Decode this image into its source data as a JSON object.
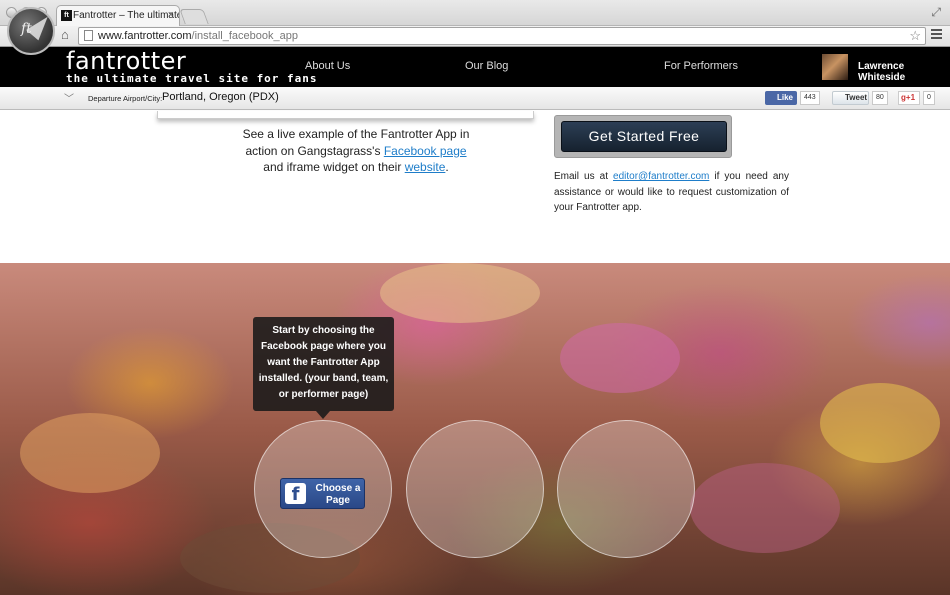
{
  "browser": {
    "tab_title": "Fantrotter – The ultimate t",
    "tab_favicon": "ft",
    "url_domain": "www.fantrotter.com",
    "url_path": "/install_facebook_app"
  },
  "header": {
    "brand_name": "fantrotter",
    "brand_tagline": "the ultimate travel site for fans",
    "logo_text": "ft",
    "nav": [
      "About Us",
      "Our Blog",
      "For Performers"
    ],
    "user_name": "Lawrence Whiteside"
  },
  "departure": {
    "label": "Departure Airport/City:",
    "value": "Portland, Oregon (PDX)"
  },
  "social": {
    "like_label": "Like",
    "like_count": "443",
    "tweet_label": "Tweet",
    "tweet_count": "80",
    "gplus_label": "+1",
    "gplus_count": "0"
  },
  "content": {
    "live_text_1": "See a live example of the Fantrotter App in action on Gangstagrass's ",
    "facebook_link": "Facebook page",
    "live_text_2": " and iframe widget on their ",
    "website_link": "website",
    "live_text_3": ".",
    "cta_label": "Get Started Free",
    "email_prefix": "Email us at ",
    "email_link": "editor@fantrotter.com",
    "email_suffix": " if you need any assistance or would like to request customization of your Fantrotter app."
  },
  "hero": {
    "tooltip": "Start by choosing the Facebook page where you want the Fantrotter App installed. (your band, team, or performer page)",
    "choose_label": "Choose a Page",
    "choose_icon": "f"
  },
  "colors": {
    "link": "#1e7dc9",
    "header_bg": "#000000",
    "cta_bg": "#1f2f42",
    "facebook_blue": "#3b5998"
  }
}
